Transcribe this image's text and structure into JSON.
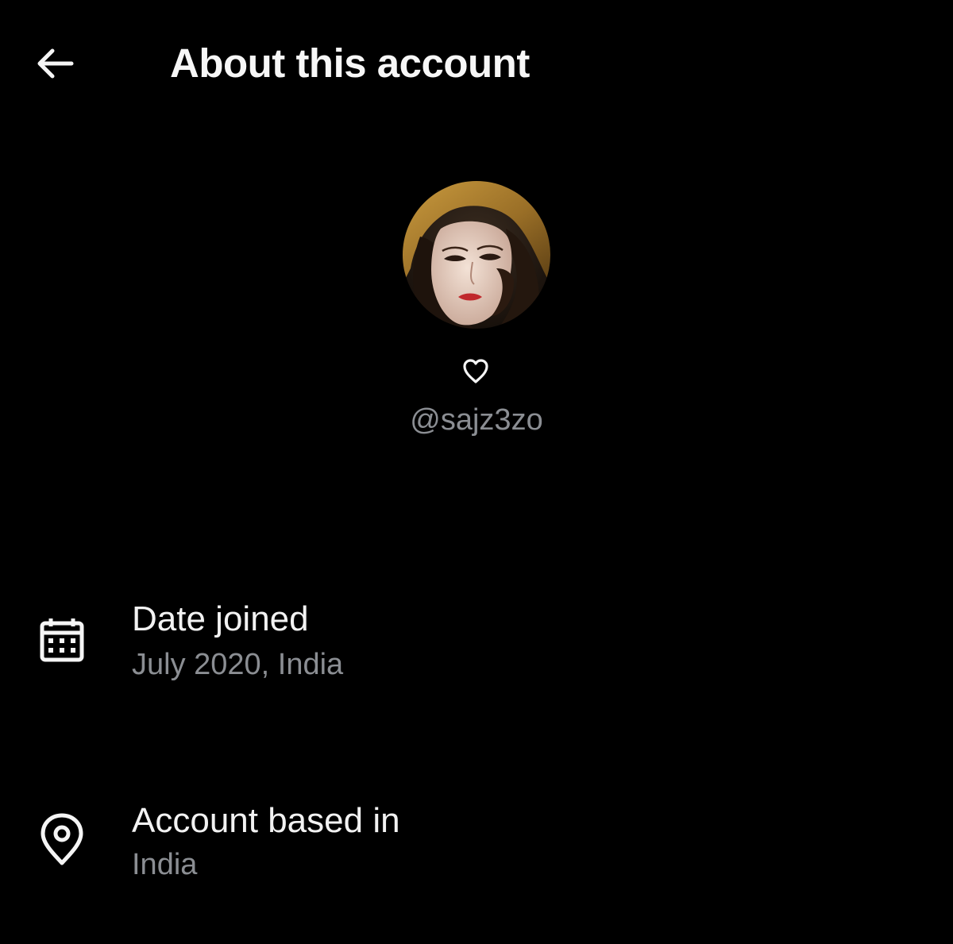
{
  "header": {
    "title": "About this account",
    "back_icon": "arrow-left-icon"
  },
  "profile": {
    "avatar_icon": "portrait-avatar",
    "badge_icon": "heart-outline-icon",
    "handle": "@sajz3zo"
  },
  "details": [
    {
      "icon": "calendar-icon",
      "label": "Date joined",
      "value": "July 2020, India"
    },
    {
      "icon": "location-pin-icon",
      "label": "Account based in",
      "value": "India"
    }
  ],
  "colors": {
    "background": "#000000",
    "primary_text": "#f5f5f5",
    "secondary_text": "#8b8e93"
  }
}
